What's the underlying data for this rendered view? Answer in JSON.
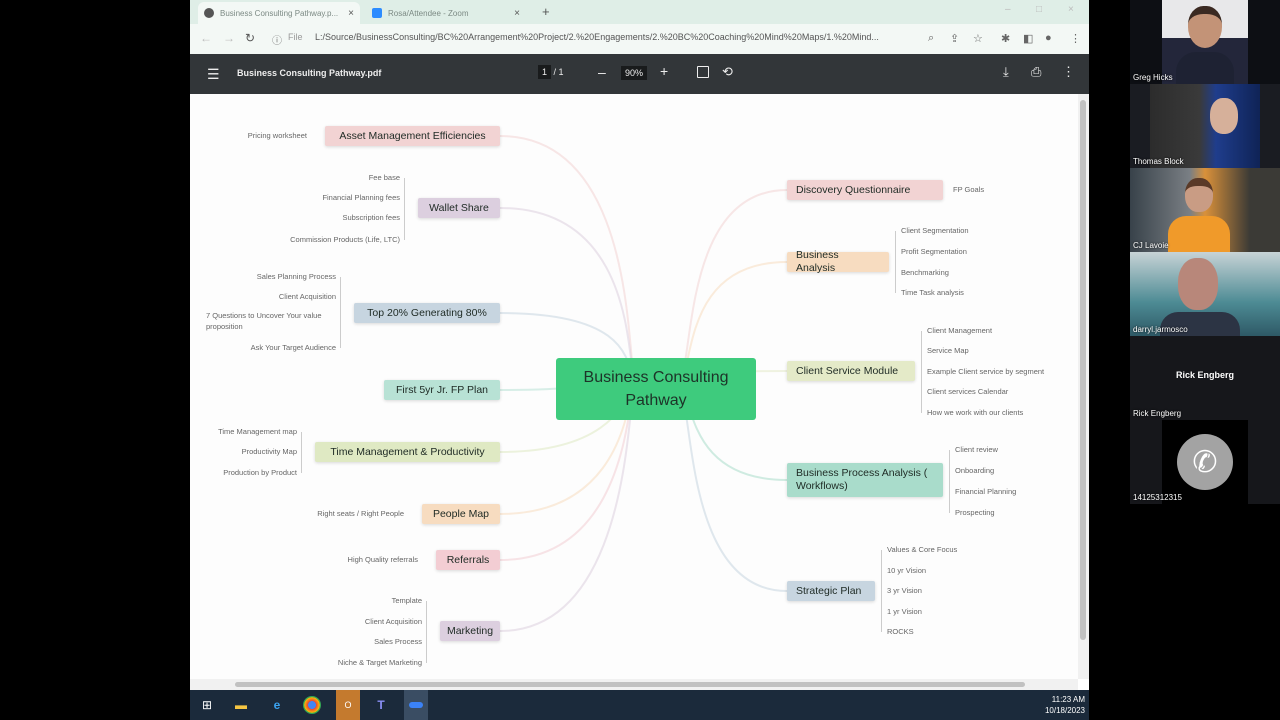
{
  "browser": {
    "tabs": [
      {
        "label": "Business Consulting Pathway.p...",
        "icon": "globe-icon",
        "active": true
      },
      {
        "label": "Rosa/Attendee - Zoom",
        "icon": "zoom-icon",
        "active": false
      }
    ],
    "new_tab": "+",
    "url_prefix": "File",
    "url": "L:/Source/BusinessConsulting/BC%20Arrangement%20Project/2.%20Engagements/2.%20BC%20Coaching%20Mind%20Maps/1.%20Mind...",
    "window_controls": [
      "–",
      "□",
      "×"
    ]
  },
  "pdf_toolbar": {
    "title": "Business Consulting Pathway.pdf",
    "page_current": "1",
    "page_total": "/ 1",
    "zoom": "90%",
    "minus": "–",
    "plus": "+"
  },
  "mindmap": {
    "central": "Business Consulting Pathway",
    "colors": {
      "central": "#3ecb7d"
    },
    "left_branches": [
      {
        "label": "Asset Management Efficiencies",
        "color": "#f2d3d3",
        "leaves": [
          "Pricing worksheet"
        ]
      },
      {
        "label": "Wallet Share",
        "color": "#dccfdf",
        "leaves": [
          "Fee base",
          "Financial Planning fees",
          "Subscription fees",
          "Commission Products (Life, LTC)"
        ]
      },
      {
        "label": "Top 20% Generating 80%",
        "color": "#c7d5e0",
        "leaves": [
          "Sales Planning Process",
          "Client Acquisition",
          "7 Questions to Uncover Your value proposition",
          "Ask Your Target Audience"
        ]
      },
      {
        "label": "First 5yr Jr. FP Plan",
        "color": "#b8e2d5",
        "leaves": []
      },
      {
        "label": "Time Management & Productivity",
        "color": "#dfe9c3",
        "leaves": [
          "Time Management map",
          "Productivity Map",
          "Production by Product"
        ]
      },
      {
        "label": "People Map",
        "color": "#f7dcc0",
        "leaves": [
          "Right seats / Right People"
        ]
      },
      {
        "label": "Referrals",
        "color": "#f3cdd3",
        "leaves": [
          "High Quality referrals"
        ]
      },
      {
        "label": "Marketing",
        "color": "#dccfdf",
        "leaves": [
          "Template",
          "Client Acquisition",
          "Sales Process",
          "Niche & Target Marketing"
        ]
      }
    ],
    "right_branches": [
      {
        "label": "Discovery Questionnaire",
        "color": "#f2d3d3",
        "leaves": [
          "FP Goals"
        ]
      },
      {
        "label": "Business Analysis",
        "color": "#f7dcc0",
        "leaves": [
          "Client Segmentation",
          "Profit Segmentation",
          "Benchmarking",
          "Time Task analysis"
        ]
      },
      {
        "label": "Client Service Module",
        "color": "#e4eac8",
        "leaves": [
          "Client Management",
          "Service Map",
          "Example Client service by segment",
          "Client services Calendar",
          "How we work with our clients"
        ]
      },
      {
        "label": "Business Process Analysis ( Workflows)",
        "color": "#a9dccb",
        "leaves": [
          "Client review",
          "Onboarding",
          "Financial Planning",
          "Prospecting"
        ]
      },
      {
        "label": "Strategic Plan",
        "color": "#c7d5e0",
        "leaves": [
          "Values & Core Focus",
          "10 yr Vision",
          "3 yr Vision",
          "1 yr Vision",
          "ROCKS"
        ]
      }
    ]
  },
  "taskbar": {
    "apps": [
      "windows-start",
      "file-explorer",
      "internet-explorer",
      "chrome",
      "outlook",
      "teams",
      "zoom"
    ],
    "time": "11:23 AM",
    "date": "10/18/2023"
  },
  "participants": [
    {
      "name": "Greg Hicks"
    },
    {
      "name": "Thomas Block"
    },
    {
      "name": "CJ Lavoie"
    },
    {
      "name": "darryl.jarmosco"
    },
    {
      "name": "Rick Engberg",
      "title": "Rick Engberg",
      "audio_only": true
    },
    {
      "name": "14125312315",
      "phone": true
    }
  ]
}
